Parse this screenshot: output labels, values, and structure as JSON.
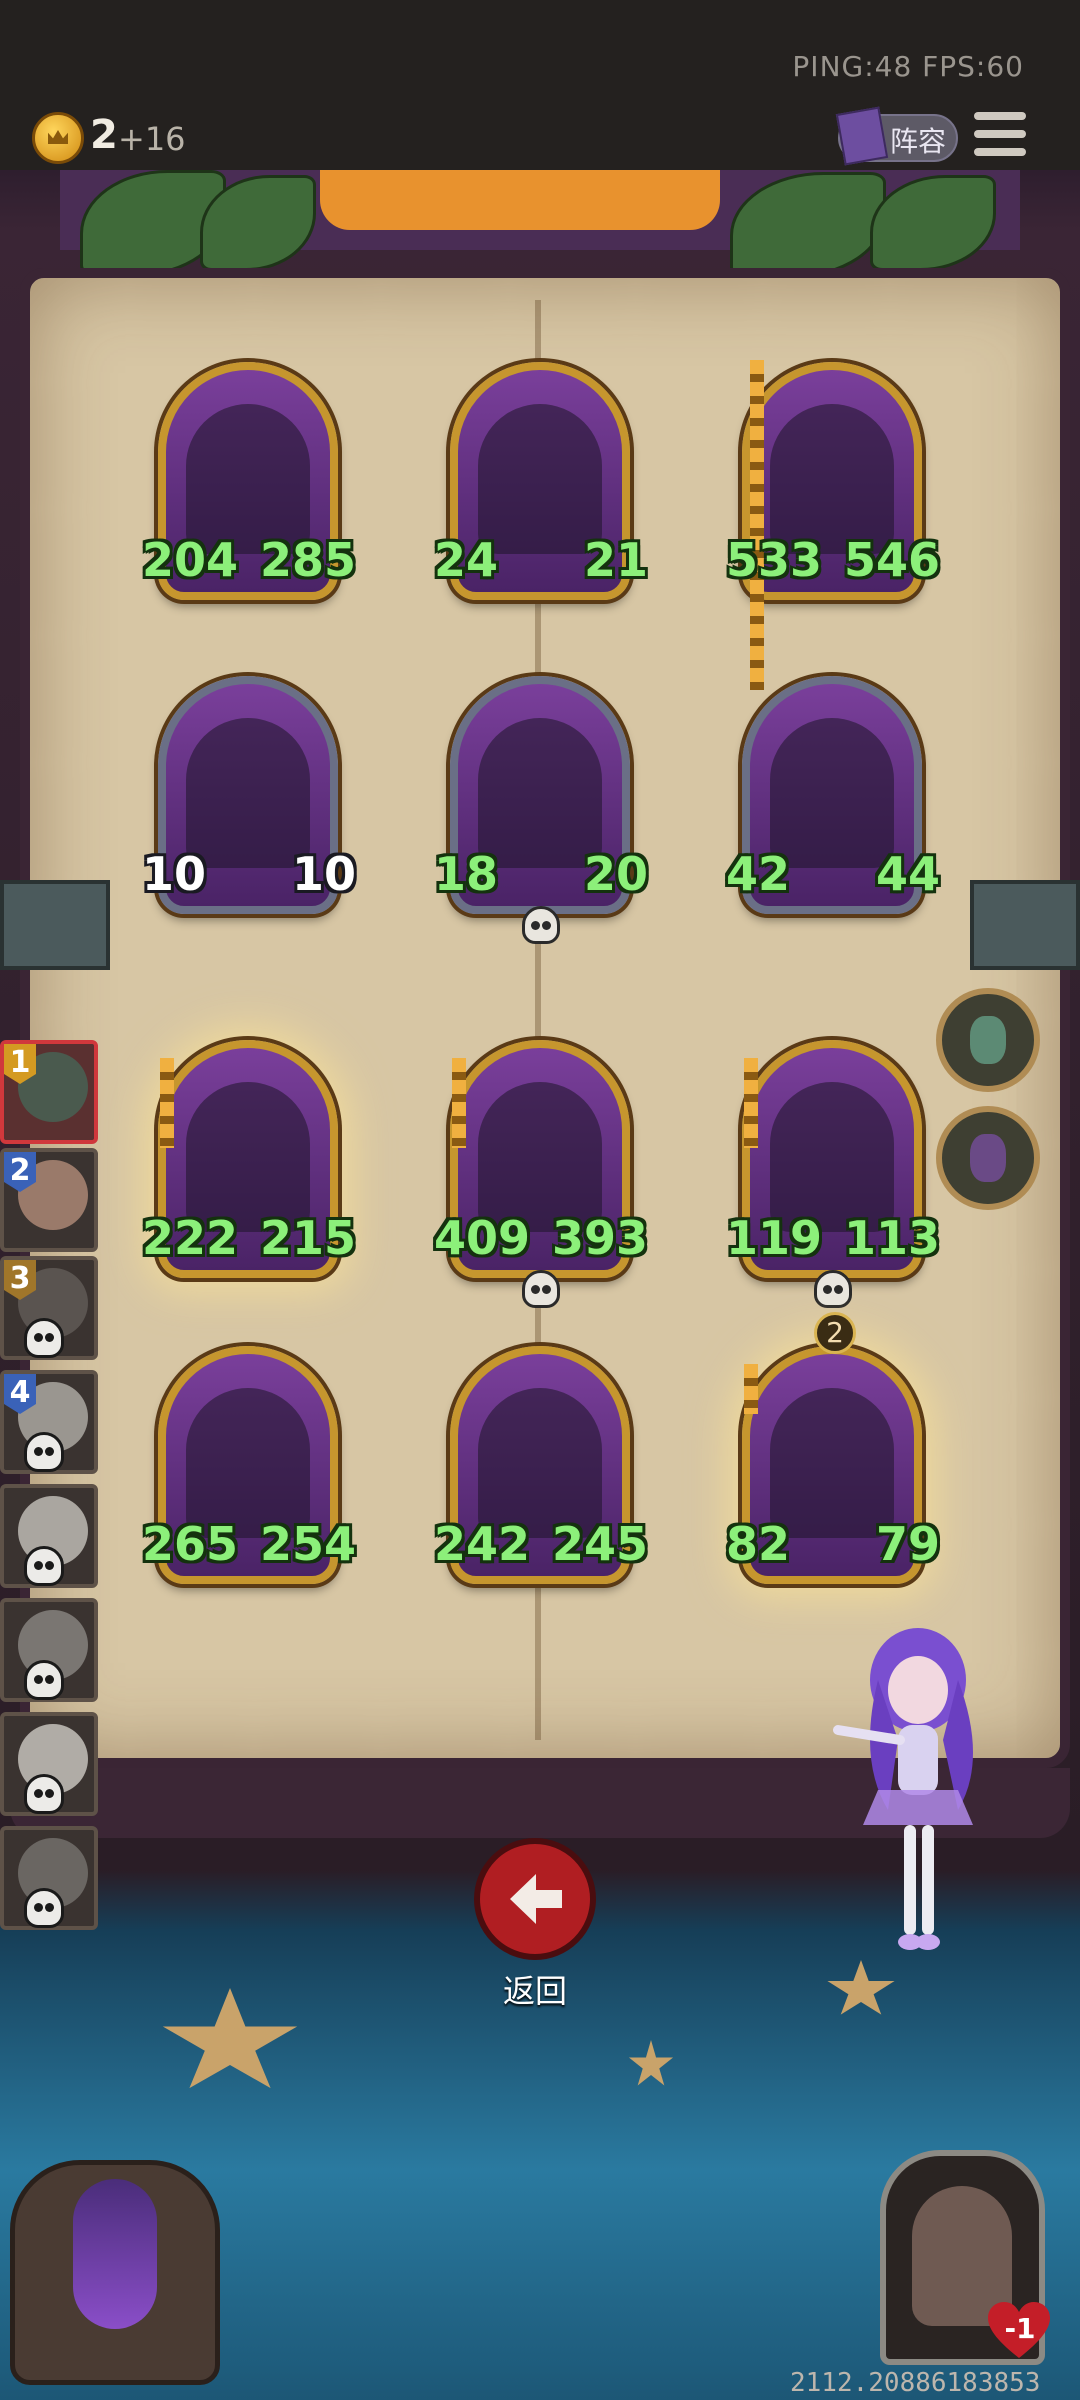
{
  "status": {
    "ping_fps": "PING:48   FPS:60"
  },
  "currency": {
    "count": "2",
    "bonus": "+16"
  },
  "header": {
    "roster_label": "阵容"
  },
  "board": {
    "rows": [
      [
        {
          "atk": "204",
          "hp": "285"
        },
        {
          "atk": "24",
          "hp": "21"
        },
        {
          "atk": "533",
          "hp": "546"
        }
      ],
      [
        {
          "atk": "10",
          "hp": "10"
        },
        {
          "atk": "18",
          "hp": "20"
        },
        {
          "atk": "42",
          "hp": "44"
        }
      ],
      [
        {
          "atk": "222",
          "hp": "215"
        },
        {
          "atk": "409",
          "hp": "393"
        },
        {
          "atk": "119",
          "hp": "113"
        }
      ],
      [
        {
          "atk": "265",
          "hp": "254"
        },
        {
          "atk": "242",
          "hp": "245"
        },
        {
          "atk": "82",
          "hp": "79"
        }
      ]
    ],
    "tier_badge": "2"
  },
  "players": [
    {
      "rank": "1"
    },
    {
      "rank": "2"
    },
    {
      "rank": "3"
    },
    {
      "rank": "4"
    }
  ],
  "back_button": {
    "label": "返回"
  },
  "health_badge": {
    "value": "-1"
  },
  "session_id": "2112.20886183853",
  "colors": {
    "gold": "#c6962e",
    "stat_green": "#8cf07a",
    "danger": "#b01e22"
  }
}
